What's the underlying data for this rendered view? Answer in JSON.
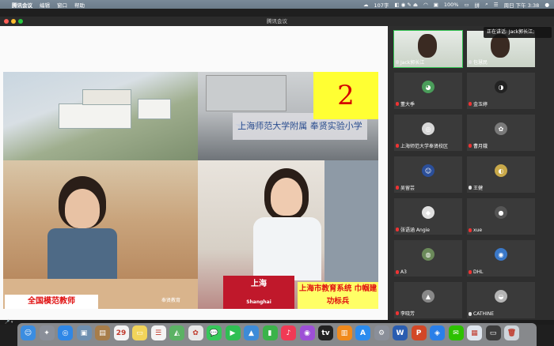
{
  "menubar": {
    "app": "腾讯会议",
    "menus": [
      "编辑",
      "窗口",
      "帮助"
    ],
    "ime": "107字",
    "battery": "100%",
    "clock": "周日 下午 3:38"
  },
  "window": {
    "title": "腾讯会议"
  },
  "toast": {
    "label": "正在讲话: Jack郭长江;"
  },
  "slide": {
    "number": "2",
    "caption_left": "全国模范教师",
    "caption_right": "上海市教育系统 巾帼建功标兵",
    "school_sign": "上海师范大学附属 奉贤实验小学",
    "podium_text": "上海",
    "podium_sub": "Shanghai",
    "watermark": "奉贤教育"
  },
  "participants": [
    {
      "name": "Jack郭长江",
      "video": true,
      "speaking": true,
      "mic": "on",
      "avatar": ""
    },
    {
      "name": "包慧民",
      "video": true,
      "speaking": false,
      "mic": "on",
      "avatar": ""
    },
    {
      "name": "董大季",
      "video": false,
      "speaking": false,
      "mic": "muted",
      "avatar": "◕"
    },
    {
      "name": "金玉婷",
      "video": false,
      "speaking": false,
      "mic": "muted",
      "avatar": "◑"
    },
    {
      "name": "上海师范大学奉贤校区",
      "video": false,
      "speaking": false,
      "mic": "muted",
      "avatar": "◎"
    },
    {
      "name": "曹月娥",
      "video": false,
      "speaking": false,
      "mic": "muted",
      "avatar": "✿"
    },
    {
      "name": "吴留芸",
      "video": false,
      "speaking": false,
      "mic": "muted",
      "avatar": "☺"
    },
    {
      "name": "王健",
      "video": false,
      "speaking": false,
      "mic": "on",
      "avatar": "◐"
    },
    {
      "name": "张语涵 Angie",
      "video": false,
      "speaking": false,
      "mic": "muted",
      "avatar": "◆"
    },
    {
      "name": "xue",
      "video": false,
      "speaking": false,
      "mic": "muted",
      "avatar": "●"
    },
    {
      "name": "A3",
      "video": false,
      "speaking": false,
      "mic": "muted",
      "avatar": "◍"
    },
    {
      "name": "DHL",
      "video": false,
      "speaking": false,
      "mic": "muted",
      "avatar": "◉"
    },
    {
      "name": "李晓芳",
      "video": false,
      "speaking": false,
      "mic": "muted",
      "avatar": "▲"
    },
    {
      "name": "CATHINE",
      "video": false,
      "speaking": false,
      "mic": "on",
      "avatar": "◒"
    }
  ],
  "dock": {
    "apps": [
      {
        "name": "finder-icon",
        "color": "#3b8de0",
        "glyph": "☺"
      },
      {
        "name": "launchpad-icon",
        "color": "#8a8f99",
        "glyph": "✦"
      },
      {
        "name": "safari-icon",
        "color": "#2f87e6",
        "glyph": "◎"
      },
      {
        "name": "photo-icon",
        "color": "#6e8fb0",
        "glyph": "▣"
      },
      {
        "name": "notes-brown-icon",
        "color": "#a77d4a",
        "glyph": "▤"
      },
      {
        "name": "calendar-icon",
        "color": "#f4f4f4",
        "glyph": "29"
      },
      {
        "name": "notes-icon",
        "color": "#f2d45a",
        "glyph": "▭"
      },
      {
        "name": "reminders-icon",
        "color": "#f4f4f4",
        "glyph": "☰"
      },
      {
        "name": "maps-icon",
        "color": "#5bb264",
        "glyph": "◭"
      },
      {
        "name": "photos-icon",
        "color": "#e8e8e8",
        "glyph": "✿"
      },
      {
        "name": "messages-icon",
        "color": "#36c85a",
        "glyph": "💬"
      },
      {
        "name": "facetime-icon",
        "color": "#2fbf53",
        "glyph": "▶"
      },
      {
        "name": "keynote-icon",
        "color": "#3d8bd8",
        "glyph": "▲"
      },
      {
        "name": "numbers-icon",
        "color": "#3bb34a",
        "glyph": "▮"
      },
      {
        "name": "music-icon",
        "color": "#f03a55",
        "glyph": "♪"
      },
      {
        "name": "podcasts-icon",
        "color": "#9d4fd6",
        "glyph": "◉"
      },
      {
        "name": "tv-icon",
        "color": "#222222",
        "glyph": "tv"
      },
      {
        "name": "books-icon",
        "color": "#f08a1c",
        "glyph": "▥"
      },
      {
        "name": "appstore-icon",
        "color": "#2b8cef",
        "glyph": "A"
      },
      {
        "name": "settings-icon",
        "color": "#8a8f99",
        "glyph": "⚙"
      },
      {
        "name": "word-icon",
        "color": "#2a5db0",
        "glyph": "W"
      },
      {
        "name": "powerpoint-icon",
        "color": "#d24726",
        "glyph": "P"
      },
      {
        "name": "tencent-meeting-icon",
        "color": "#2a7fe8",
        "glyph": "◈"
      },
      {
        "name": "wechat-icon",
        "color": "#2dc100",
        "glyph": "✉"
      },
      {
        "name": "preview-icon",
        "color": "#dfe6ee",
        "glyph": "▦"
      },
      {
        "name": "screenshot-icon",
        "color": "#3c3c3c",
        "glyph": "▭"
      },
      {
        "name": "trash-icon",
        "color": "#cfd5db",
        "glyph": "🗑"
      }
    ]
  }
}
